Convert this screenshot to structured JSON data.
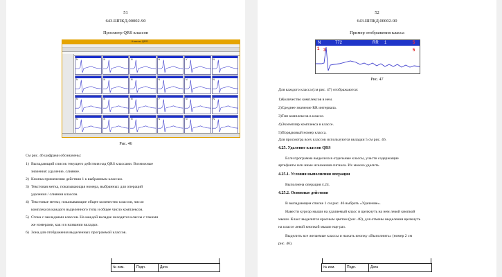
{
  "left": {
    "page_number": "51",
    "doc_code": "643.ШПКД.00002-90",
    "title": "Просмотр QRS классов",
    "window_title": "Классы QRS",
    "cell_labels": [
      "N",
      "N",
      "N",
      "N",
      "V",
      "N",
      "N",
      "N",
      "N",
      "N",
      "N",
      "N",
      "N",
      "N",
      "N",
      "V",
      "N",
      "N",
      "N",
      "N",
      "N",
      "N",
      "N",
      "N"
    ],
    "figure_caption": "Рис. 46",
    "intro": "См рис. 46 цифрами обозначены:",
    "items": [
      {
        "n": "1)",
        "text": "Выпадающий список текущего действия над QRS классами. Возможные",
        "cont": "значения: удаление, слияние."
      },
      {
        "n": "2)",
        "text": "Кнопка применения действия 1 к выбранным классам.",
        "cont": ""
      },
      {
        "n": "3)",
        "text": "Текстовая метка, показывающая номера, выбранных для операций",
        "cont": "удаления / слияния классов."
      },
      {
        "n": "4)",
        "text": "Текстовые метки, показывающие общее количество классов, число",
        "cont": "комплексов каждого выделенного типа и общее число комплексов."
      },
      {
        "n": "5)",
        "text": "Стока с закладками классов. На каждой вкладке находятся классы с такими",
        "cont": "же номерами, как и в названии вкладки."
      },
      {
        "n": "6)",
        "text": "Зона для отображения выделенных программой классов.",
        "cont": ""
      }
    ],
    "stamp": [
      "№ изм.",
      "Подп.",
      "Дата"
    ]
  },
  "right": {
    "page_number": "52",
    "doc_code": "643.ШПКД.00002-90",
    "title": "Пример отображения класса",
    "example": {
      "class_label": "N",
      "count": "772",
      "rr_label": "RR",
      "rr_value": "1",
      "index": "5"
    },
    "figure_caption": "Рис. 47",
    "intro": "Для каждого класса (см рис. 47) отображаются:",
    "items": [
      "1)Количество комплексов в нем.",
      "2)Среднее значение RR интервала.",
      "3)Тип комплексов в классе.",
      "4)Экземпляр комплекса в классе.",
      "5)Порядковый номер класса."
    ],
    "note": "Для просмотра всех классов используются вкладки 5 см рис. 46.",
    "h1": "4.25. Удаление классов QRS",
    "p1a": "Если программа выделила в отдельные классы, участи содержащие",
    "p1b": "артефакты или иные искажения сигнала. Их можно удалить.",
    "h2": "4.25.1. Условия выполнения операции",
    "p2": "Выполнена операция 4.24.",
    "h3": "4.25.2. Основные действия",
    "p3": "В выпадающем списке 1 см рис. 46 выбрать «Удаление».",
    "p4a": "Навести курсор мыши на удаляемый класс и щелкнуть на нем левой кнопкой",
    "p4b": "мыши. Класс выделится красным цветом (рис. 48), для отмены выделения щелкнуть",
    "p4c": "на классе левой кнопкой мыши еще раз.",
    "p5a": "Выделить все желаемые классы и нажать кнопку «Выполнить» (номер 2 см",
    "p5b": "рис. 46).",
    "stamp": [
      "№ изм.",
      "Подп.",
      "Дата"
    ]
  },
  "colors": {
    "class_header": "#1a2fcc",
    "waveform": "#3a3acc",
    "window_frame": "#e5a400",
    "index_red": "#e01010"
  }
}
